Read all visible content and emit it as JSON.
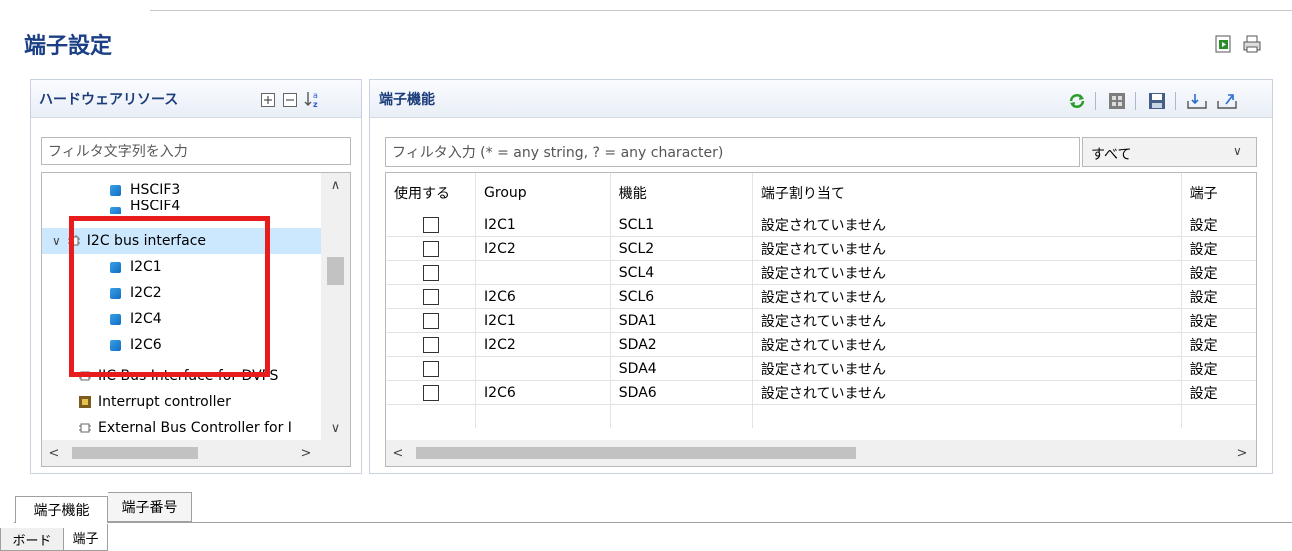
{
  "window": {
    "title": "端子設定"
  },
  "hardware_panel": {
    "title": "ハードウェアリソース",
    "filter_placeholder": "フィルタ文字列を入力",
    "tree": [
      {
        "label": "HSCIF3",
        "kind": "leaf"
      },
      {
        "label": "HSCIF4",
        "kind": "leaf"
      },
      {
        "label": "I2C bus interface",
        "kind": "group",
        "expanded": true,
        "selected": true
      },
      {
        "label": "I2C1",
        "kind": "leaf"
      },
      {
        "label": "I2C2",
        "kind": "leaf"
      },
      {
        "label": "I2C4",
        "kind": "leaf"
      },
      {
        "label": "I2C6",
        "kind": "leaf"
      },
      {
        "label": "IIC Bus Interface for DVFS",
        "kind": "group"
      },
      {
        "label": "Interrupt controller",
        "kind": "group"
      },
      {
        "label": "External Bus Controller for I",
        "kind": "group"
      }
    ]
  },
  "function_panel": {
    "title": "端子機能",
    "filter_placeholder": "フィルタ入力 (* = any string, ? = any character)",
    "filter_select_value": "すべて",
    "columns": [
      "使用する",
      "Group",
      "機能",
      "端子割り当て",
      "端子"
    ],
    "rows": [
      {
        "group": "I2C1",
        "func": "SCL1",
        "assign": "設定されていません",
        "pin": "設定"
      },
      {
        "group": "I2C2",
        "func": "SCL2",
        "assign": "設定されていません",
        "pin": "設定"
      },
      {
        "group": "",
        "func": "SCL4",
        "assign": "設定されていません",
        "pin": "設定"
      },
      {
        "group": "I2C6",
        "func": "SCL6",
        "assign": "設定されていません",
        "pin": "設定"
      },
      {
        "group": "I2C1",
        "func": "SDA1",
        "assign": "設定されていません",
        "pin": "設定"
      },
      {
        "group": "I2C2",
        "func": "SDA2",
        "assign": "設定されていません",
        "pin": "設定"
      },
      {
        "group": "",
        "func": "SDA4",
        "assign": "設定されていません",
        "pin": "設定"
      },
      {
        "group": "I2C6",
        "func": "SDA6",
        "assign": "設定されていません",
        "pin": "設定"
      }
    ]
  },
  "bottom_tabs": [
    "端子機能",
    "端子番号"
  ],
  "editor_tabs": [
    "ボード",
    "端子"
  ],
  "colors": {
    "title": "#1a3f84",
    "highlight": "#e81c1c",
    "selection": "#cce8ff"
  }
}
